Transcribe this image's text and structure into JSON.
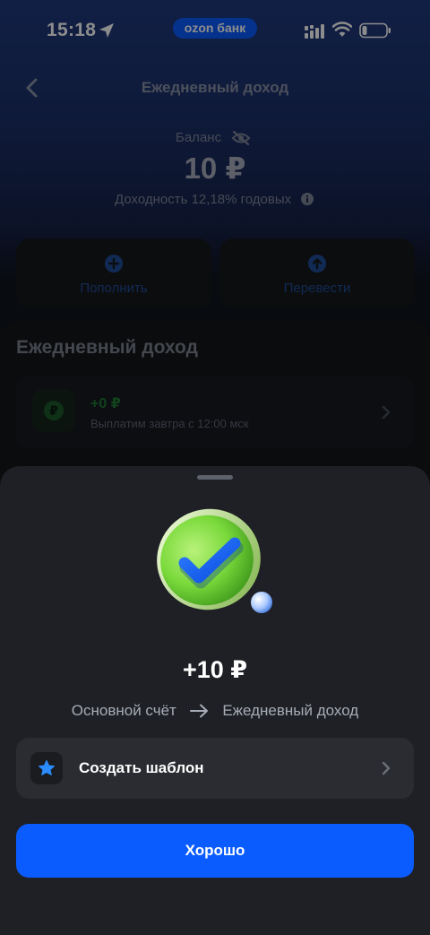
{
  "status_bar": {
    "time": "15:18",
    "brand": "ozon банк"
  },
  "header": {
    "title": "Ежедневный доход",
    "back_icon": "chevron-left-icon"
  },
  "balance": {
    "label": "Баланс",
    "value": "10 ₽",
    "yield": "Доходность 12,18% годовых"
  },
  "actions": [
    {
      "label": "Пополнить",
      "icon": "plus-circle-icon"
    },
    {
      "label": "Перевести",
      "icon": "arrow-up-circle-icon"
    }
  ],
  "income_section": {
    "title": "Ежедневный доход",
    "row": {
      "amount": "+0 ₽",
      "subtitle": "Выплатим завтра с 12:00 мск",
      "icon": "ruble-coin-icon"
    }
  },
  "sheet": {
    "amount": "+10 ₽",
    "from_account": "Основной счёт",
    "to_account": "Ежедневный доход",
    "template_label": "Создать шаблон",
    "ok_label": "Хорошо"
  },
  "colors": {
    "accent": "#0a5cff",
    "success_green": "#2fbf4a",
    "sheet_bg": "#1e2025"
  }
}
